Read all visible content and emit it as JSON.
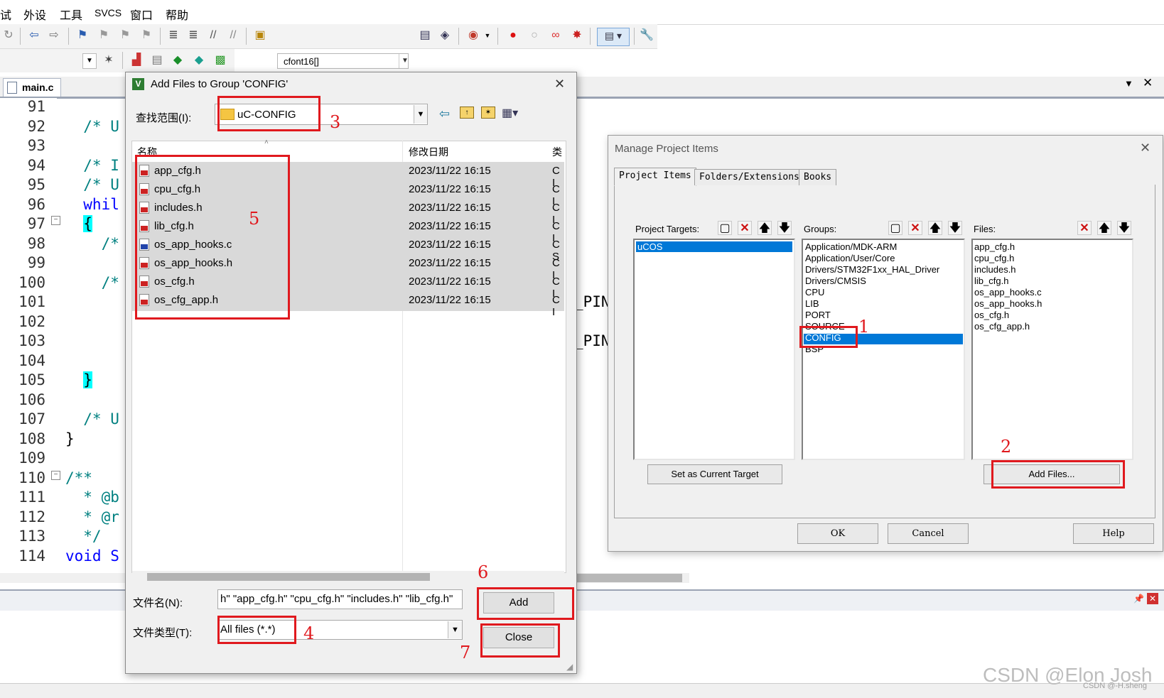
{
  "menu": [
    "试",
    "外设",
    "工具",
    "SVCS",
    "窗口",
    "帮助"
  ],
  "toolbar": {
    "target_combo": "cfont16[]"
  },
  "editor": {
    "tab": "main.c",
    "lines": [
      {
        "n": "91",
        "code": ""
      },
      {
        "n": "92",
        "code": "  /* U"
      },
      {
        "n": "93",
        "code": ""
      },
      {
        "n": "94",
        "code": "  /* I"
      },
      {
        "n": "95",
        "code": "  /* U"
      },
      {
        "n": "96",
        "code": "  whil"
      },
      {
        "n": "97",
        "code": "  {"
      },
      {
        "n": "98",
        "code": "    /*"
      },
      {
        "n": "99",
        "code": ""
      },
      {
        "n": "100",
        "code": "    /*"
      },
      {
        "n": "101",
        "code": ""
      },
      {
        "n": "102",
        "code": ""
      },
      {
        "n": "103",
        "code": ""
      },
      {
        "n": "104",
        "code": ""
      },
      {
        "n": "105",
        "code": "  }"
      },
      {
        "n": "106",
        "code": ""
      },
      {
        "n": "107",
        "code": "  /* U"
      },
      {
        "n": "108",
        "code": "}"
      },
      {
        "n": "109",
        "code": ""
      },
      {
        "n": "110",
        "code": "/**"
      },
      {
        "n": "111",
        "code": "  * @b"
      },
      {
        "n": "112",
        "code": "  * @r"
      },
      {
        "n": "113",
        "code": "  */"
      },
      {
        "n": "114",
        "code": "void S"
      }
    ],
    "right_fragments": [
      "_PIN",
      "_PIN"
    ]
  },
  "add_dialog": {
    "title": "Add Files to Group 'CONFIG'",
    "look_in_label": "查找范围(I):",
    "look_in_value": "uC-CONFIG",
    "columns": {
      "name": "名称",
      "date": "修改日期",
      "type": "类"
    },
    "files": [
      {
        "name": "app_cfg.h",
        "date": "2023/11/22 16:15",
        "type": "C I",
        "kind": "h"
      },
      {
        "name": "cpu_cfg.h",
        "date": "2023/11/22 16:15",
        "type": "C I",
        "kind": "h"
      },
      {
        "name": "includes.h",
        "date": "2023/11/22 16:15",
        "type": "C I",
        "kind": "h"
      },
      {
        "name": "lib_cfg.h",
        "date": "2023/11/22 16:15",
        "type": "C I",
        "kind": "h"
      },
      {
        "name": "os_app_hooks.c",
        "date": "2023/11/22 16:15",
        "type": "C S",
        "kind": "c"
      },
      {
        "name": "os_app_hooks.h",
        "date": "2023/11/22 16:15",
        "type": "C I",
        "kind": "h"
      },
      {
        "name": "os_cfg.h",
        "date": "2023/11/22 16:15",
        "type": "C I",
        "kind": "h"
      },
      {
        "name": "os_cfg_app.h",
        "date": "2023/11/22 16:15",
        "type": "C I",
        "kind": "h"
      }
    ],
    "file_name_label": "文件名(N):",
    "file_name_value": "h\" \"app_cfg.h\" \"cpu_cfg.h\" \"includes.h\" \"lib_cfg.h\"",
    "file_type_label": "文件类型(T):",
    "file_type_value": "All files (*.*)",
    "add_label": "Add",
    "close_label": "Close"
  },
  "manage_dialog": {
    "title": "Manage Project Items",
    "tabs": [
      "Project Items",
      "Folders/Extensions",
      "Books"
    ],
    "targets_label": "Project Targets:",
    "targets": [
      "uCOS"
    ],
    "groups_label": "Groups:",
    "groups": [
      "Application/MDK-ARM",
      "Application/User/Core",
      "Drivers/STM32F1xx_HAL_Driver",
      "Drivers/CMSIS",
      "CPU",
      "LIB",
      "PORT",
      "SOURCE",
      "CONFIG",
      "BSP"
    ],
    "files_label": "Files:",
    "files": [
      "app_cfg.h",
      "cpu_cfg.h",
      "includes.h",
      "lib_cfg.h",
      "os_app_hooks.c",
      "os_app_hooks.h",
      "os_cfg.h",
      "os_cfg_app.h"
    ],
    "set_target_label": "Set as Current Target",
    "add_files_label": "Add Files...",
    "ok_label": "OK",
    "cancel_label": "Cancel",
    "help_label": "Help"
  },
  "annotations": [
    "1",
    "2",
    "3",
    "4",
    "5",
    "6",
    "7"
  ],
  "watermark": "CSDN @Elon Josh",
  "watermark_small": "CSDN @-H.sheng",
  "colors": {
    "annotation_red": "#e0191e",
    "selection_blue": "#0078d7",
    "comment_teal": "#008080",
    "keyword_blue": "#0000ff"
  }
}
